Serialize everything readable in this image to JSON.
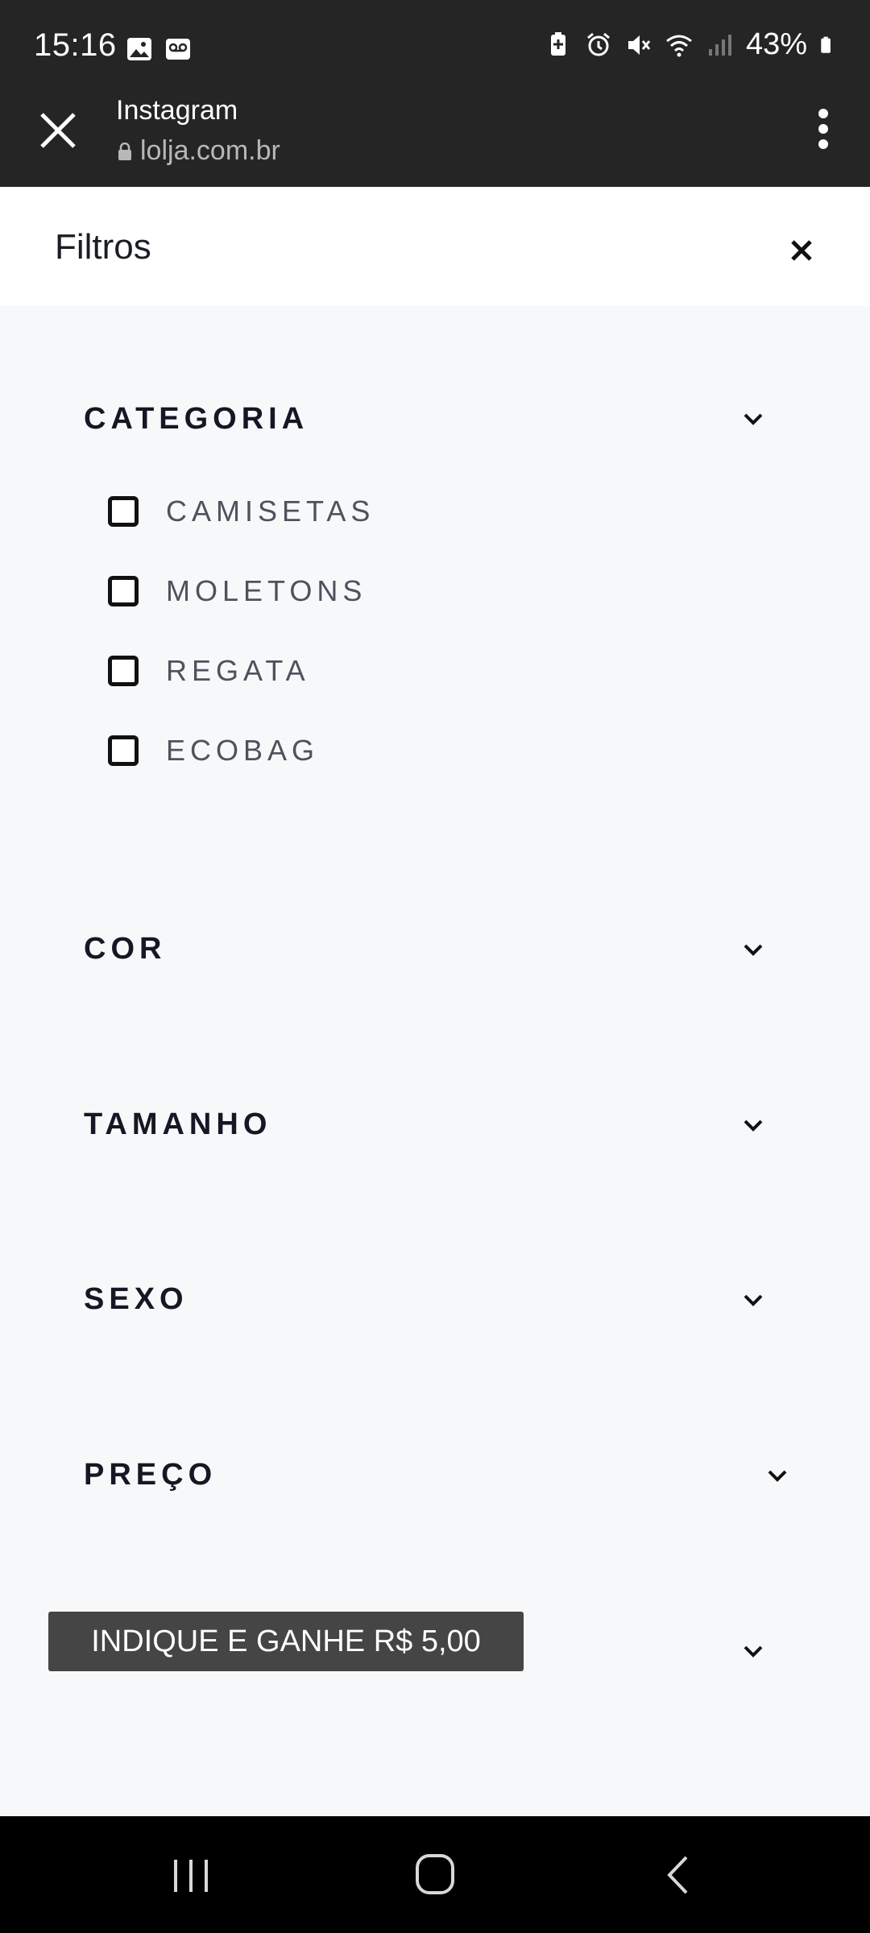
{
  "status_bar": {
    "time": "15:16",
    "battery": "43%",
    "icons": [
      "image-icon",
      "voicemail-icon",
      "battery-saver-icon",
      "alarm-icon",
      "mute-icon",
      "wifi-icon",
      "signal-icon",
      "battery-icon"
    ]
  },
  "browser": {
    "title": "Instagram",
    "url": "lolja.com.br"
  },
  "filters": {
    "title": "Filtros",
    "sections": [
      {
        "title": "CATEGORIA",
        "options": [
          "CAMISETAS",
          "MOLETONS",
          "REGATA",
          "ECOBAG"
        ]
      },
      {
        "title": "COR"
      },
      {
        "title": "TAMANHO"
      },
      {
        "title": "SEXO"
      },
      {
        "title": "PREÇO"
      }
    ]
  },
  "banner": {
    "label": "INDIQUE E GANHE R$ 5,00"
  },
  "colors": {
    "status_bg": "#252525",
    "page_bg": "#f7f8fa",
    "banner_bg": "#454545"
  }
}
